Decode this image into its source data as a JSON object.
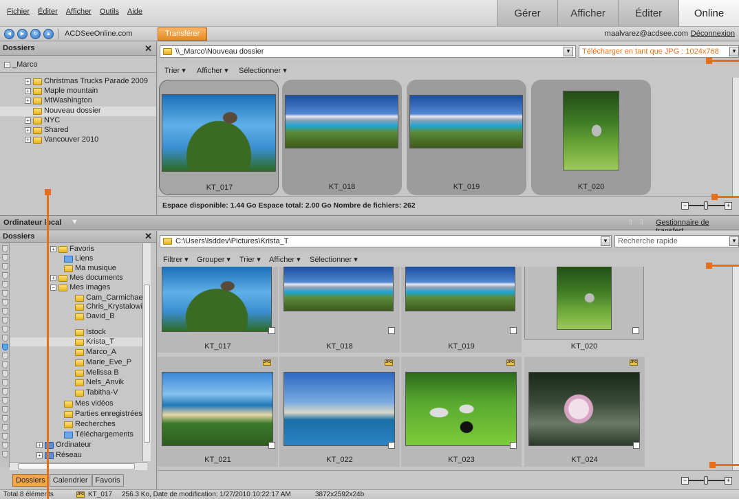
{
  "menu": [
    "Fichier",
    "Éditer",
    "Afficher",
    "Outils",
    "Aide"
  ],
  "modes": [
    "Gérer",
    "Afficher",
    "Éditer",
    "Online"
  ],
  "nav": {
    "site": "ACDSeeOnline.com",
    "upload": "Transférer",
    "user": "maalvarez@acdsee.com",
    "logout": "Déconnexion"
  },
  "online_panel": {
    "title": "Dossiers",
    "root": "_Marco",
    "folders": [
      "Christmas Trucks Parade 2009",
      "Maple mountain",
      "MtWashington",
      "Nouveau dossier",
      "NYC",
      "Shared",
      "Vancouver 2010"
    ],
    "path": "\\\\_Marco\\Nouveau dossier",
    "upload_as": "Télécharger en tant que JPG : 1024x768",
    "toolbar": [
      "Trier",
      "Afficher",
      "Sélectionner"
    ],
    "thumbs": [
      "KT_017",
      "KT_018",
      "KT_019",
      "KT_020"
    ],
    "status": "Espace disponible: 1.44 Go  Espace total: 2.00 Go  Nombre de fichiers: 262"
  },
  "local": {
    "title": "Ordinateur local",
    "transfer_mgr": "Gestionnaire de transfert"
  },
  "local_panel": {
    "title": "Dossiers",
    "folders": [
      "Favoris",
      "Liens",
      "Ma musique",
      "Mes documents",
      "Mes images",
      "Cam_Carmichael",
      "Chris_Krystalowich",
      "David_B",
      "Istock",
      "Krista_T",
      "Marco_A",
      "Marie_Eve_P",
      "Melissa B",
      "Nels_Anvik",
      "Tabitha-V",
      "Mes vidéos",
      "Parties enregistrées",
      "Recherches",
      "Téléchargements",
      "Ordinateur",
      "Réseau"
    ],
    "tabs": [
      "Dossiers",
      "Calendrier",
      "Favoris"
    ],
    "path": "C:\\Users\\lsddev\\Pictures\\Krista_T",
    "search_placeholder": "Recherche rapide",
    "toolbar": [
      "Filtrer",
      "Grouper",
      "Trier",
      "Afficher",
      "Sélectionner"
    ],
    "thumbs": [
      "KT_017",
      "KT_018",
      "KT_019",
      "KT_020",
      "KT_021",
      "KT_022",
      "KT_023",
      "KT_024"
    ],
    "badge": "JPG"
  },
  "statusbar": {
    "total": "Total 8 éléments",
    "file": "KT_017",
    "info": "256.3 Ko, Date de modification: 1/27/2010 10:22:17 AM",
    "dims": "3872x2592x24b"
  },
  "icons": [
    "back-icon",
    "forward-icon",
    "refresh-icon",
    "home-icon",
    "folder-icon",
    "close-icon",
    "dropdown-icon",
    "zoom-out-icon",
    "zoom-in-icon",
    "up-arrow-icon",
    "down-arrow-icon"
  ],
  "colors": {
    "accent": "#e86f1a",
    "panel": "#c7c7c7"
  }
}
